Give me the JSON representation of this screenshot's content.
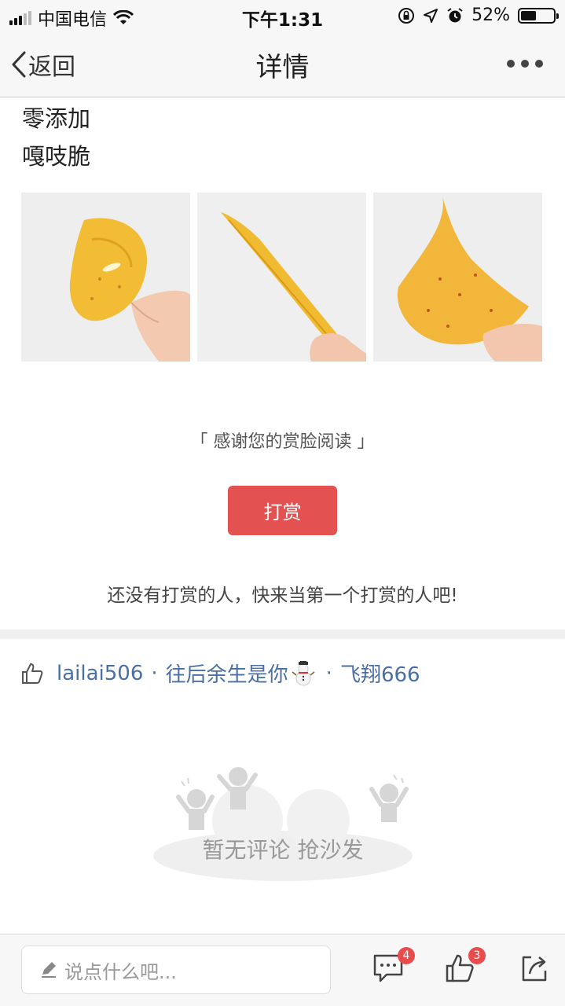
{
  "status_bar": {
    "carrier": "中国电信",
    "time": "下午1:31",
    "battery": "52%",
    "battery_level": 0.52,
    "icons": [
      "signal-icon",
      "wifi-icon",
      "lock-rotation-icon",
      "location-icon",
      "alarm-icon",
      "battery-icon"
    ]
  },
  "nav": {
    "back_label": "返回",
    "title": "详情",
    "more_icon": "more-icon"
  },
  "article": {
    "lines": [
      "零添加",
      "嘎吱脆"
    ],
    "photos": [
      "photo-chip-flat",
      "photo-chip-side",
      "photo-chip-top"
    ]
  },
  "reward": {
    "thanks_text": "「 感谢您的赏脸阅读 」",
    "button_label": "打赏",
    "empty_note": "还没有打赏的人，快来当第一个打赏的人吧!",
    "accent_color": "#e35151"
  },
  "likes": {
    "users": [
      "lailai506",
      "往后余生是你",
      "飞翔666"
    ],
    "separator": "·",
    "link_color": "#4a6fa5"
  },
  "comments": {
    "empty_text": "暂无评论 抢沙发"
  },
  "bottom_bar": {
    "input_placeholder": "说点什么吧...",
    "comment_count": "4",
    "like_count": "3"
  }
}
